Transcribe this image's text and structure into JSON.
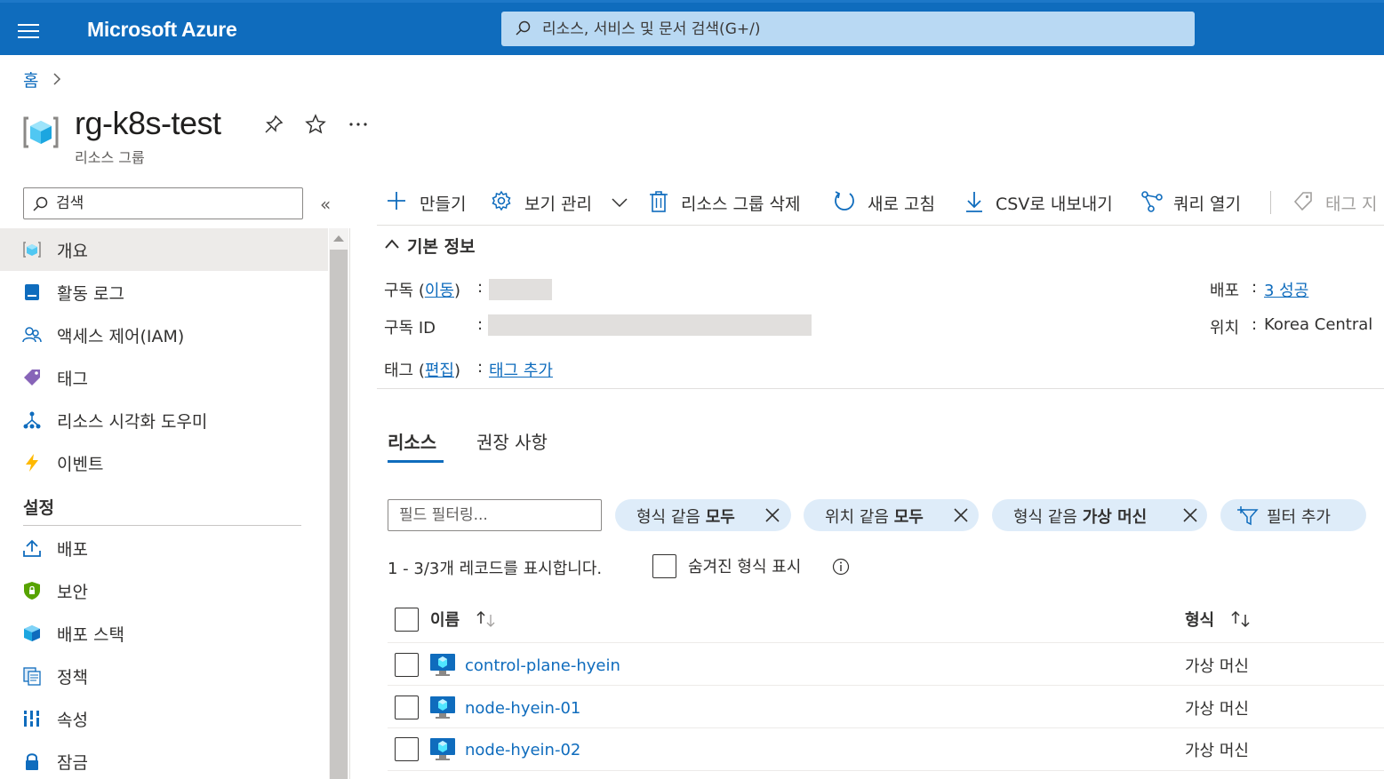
{
  "topbar": {
    "brand": "Microsoft Azure",
    "search_placeholder": "리소스, 서비스 및 문서 검색(G+/)",
    "color": "#0f6cbd"
  },
  "breadcrumb": {
    "home": "홈"
  },
  "resource": {
    "title": "rg-k8s-test",
    "subtitle": "리소스 그룹"
  },
  "nav": {
    "search_placeholder": "검색",
    "collapse_glyph": "«",
    "items": [
      {
        "label": "개요",
        "icon": "resource-group-icon"
      },
      {
        "label": "활동 로그",
        "icon": "activity-log-icon"
      },
      {
        "label": "액세스 제어(IAM)",
        "icon": "people-icon"
      },
      {
        "label": "태그",
        "icon": "tag-icon"
      },
      {
        "label": "리소스 시각화 도우미",
        "icon": "hierarchy-icon"
      },
      {
        "label": "이벤트",
        "icon": "lightning-icon"
      }
    ],
    "section_settings": "설정",
    "settings_items": [
      {
        "label": "배포",
        "icon": "upload-icon"
      },
      {
        "label": "보안",
        "icon": "shield-icon"
      },
      {
        "label": "배포 스택",
        "icon": "cube-icon"
      },
      {
        "label": "정책",
        "icon": "policy-icon"
      },
      {
        "label": "속성",
        "icon": "properties-icon"
      },
      {
        "label": "잠금",
        "icon": "lock-icon"
      }
    ]
  },
  "commands": {
    "create": "만들기",
    "manage_view": "보기 관리",
    "delete_group": "리소스 그룹 삭제",
    "refresh": "새로 고침",
    "export_csv": "CSV로 내보내기",
    "open_query": "쿼리 열기",
    "assign_tags": "태그 지"
  },
  "essentials": {
    "title": "기본 정보",
    "subscription_label_pre": "구독 (",
    "subscription_link": "이동",
    "subscription_label_post": ")",
    "subscription_id_label": "구독 ID",
    "tags_label_pre": "태그 (",
    "tags_link": "편집",
    "tags_label_post": ")",
    "tags_add": "태그 추가",
    "colon": ":",
    "deployment_label": "배포",
    "deployment_value": "3 성공",
    "location_label": "위치",
    "location_value": "Korea Central"
  },
  "tabs": [
    {
      "label": "리소스",
      "active": true
    },
    {
      "label": "권장 사항",
      "active": false
    }
  ],
  "filters": {
    "field_placeholder": "필드 필터링...",
    "pills": [
      {
        "prefix": "형식 같음 ",
        "value": "모두"
      },
      {
        "prefix": "위치 같음 ",
        "value": "모두"
      },
      {
        "prefix": "형식 같음 ",
        "value": "가상 머신"
      }
    ],
    "add_filter": "필터 추가"
  },
  "records_text": "1 - 3/3개 레코드를 표시합니다.",
  "show_hidden_types": "숨겨진 형식 표시",
  "table": {
    "columns": [
      "이름",
      "형식"
    ],
    "rows": [
      {
        "name": "control-plane-hyein",
        "type": "가상 머신"
      },
      {
        "name": "node-hyein-01",
        "type": "가상 머신"
      },
      {
        "name": "node-hyein-02",
        "type": "가상 머신"
      }
    ]
  }
}
